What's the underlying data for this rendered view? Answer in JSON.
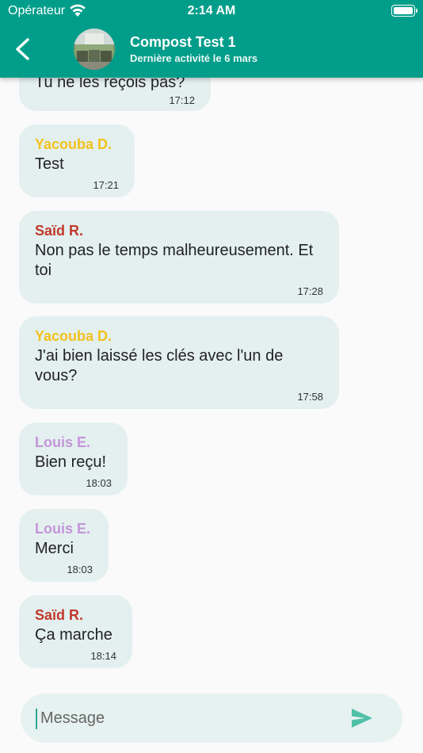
{
  "status_bar": {
    "carrier": "Opérateur",
    "time": "2:14 AM"
  },
  "header": {
    "title": "Compost Test 1",
    "subtitle": "Dernière activité le 6 mars",
    "accent_color": "#009e8a"
  },
  "messages": [
    {
      "sender": "",
      "text": "Tu ne les reçois pas?",
      "time": "17:12",
      "color": "#f2c11b"
    },
    {
      "sender": "Yacouba D.",
      "text": "Test",
      "time": "17:21",
      "color": "#f2c11b"
    },
    {
      "sender": "Saïd R.",
      "text": "Non pas le temps malheureusement. Et toi",
      "time": "17:28",
      "color": "#c0392b"
    },
    {
      "sender": "Yacouba D.",
      "text": "J'ai bien laissé les clés avec l'un de vous?",
      "time": "17:58",
      "color": "#f2c11b"
    },
    {
      "sender": "Louis E.",
      "text": "Bien reçu!",
      "time": "18:03",
      "color": "#c495d9"
    },
    {
      "sender": "Louis E.",
      "text": "Merci",
      "time": "18:03",
      "color": "#c495d9"
    },
    {
      "sender": "Saïd R.",
      "text": "Ça marche",
      "time": "18:14",
      "color": "#c0392b"
    }
  ],
  "composer": {
    "placeholder": "Message",
    "send_icon": "send-icon"
  }
}
